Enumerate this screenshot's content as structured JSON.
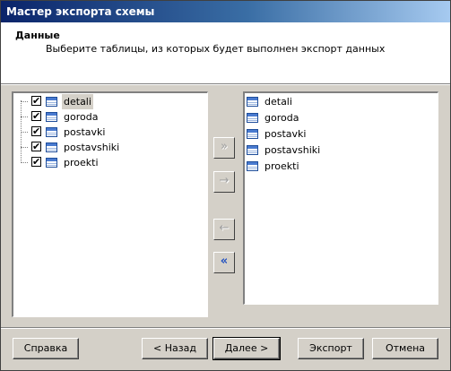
{
  "window": {
    "title": "Мастер экспорта схемы"
  },
  "header": {
    "title": "Данные",
    "subtitle": "Выберите таблицы, из которых будет выполнен экспорт данных"
  },
  "left_list": {
    "items": [
      {
        "label": "detali",
        "checked": true,
        "selected": true
      },
      {
        "label": "goroda",
        "checked": true,
        "selected": false
      },
      {
        "label": "postavki",
        "checked": true,
        "selected": false
      },
      {
        "label": "postavshiki",
        "checked": true,
        "selected": false
      },
      {
        "label": "proekti",
        "checked": true,
        "selected": false
      }
    ]
  },
  "right_list": {
    "items": [
      {
        "label": "detali"
      },
      {
        "label": "goroda"
      },
      {
        "label": "postavki"
      },
      {
        "label": "postavshiki"
      },
      {
        "label": "proekti"
      }
    ]
  },
  "move_buttons": {
    "add_all": "»",
    "add": "→",
    "remove": "←",
    "remove_all": "«"
  },
  "footer": {
    "help": "Справка",
    "back": "< Назад",
    "next": "Далее >",
    "export": "Экспорт",
    "cancel": "Отмена"
  },
  "checkmark": "✔"
}
